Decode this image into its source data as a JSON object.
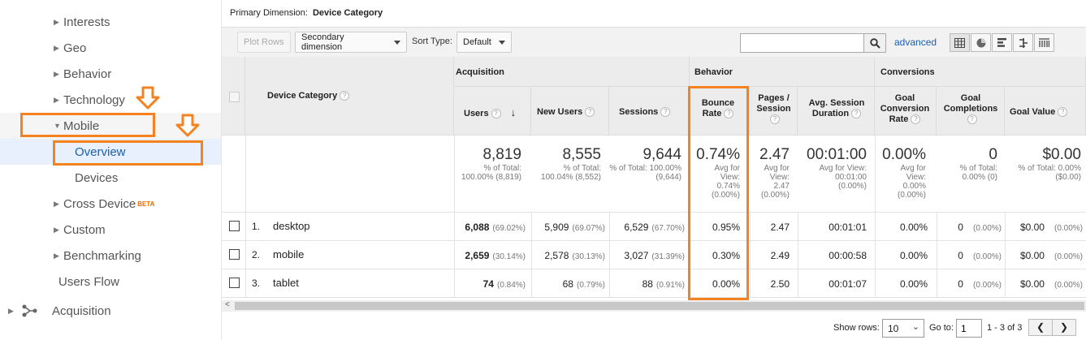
{
  "sidebar": {
    "items": [
      {
        "label": "Interests",
        "arrow": "▶"
      },
      {
        "label": "Geo",
        "arrow": "▶"
      },
      {
        "label": "Behavior",
        "arrow": "▶"
      },
      {
        "label": "Technology",
        "arrow": "▶"
      },
      {
        "label": "Mobile",
        "arrow": "▼"
      },
      {
        "label": "Overview",
        "arrow": ""
      },
      {
        "label": "Devices",
        "arrow": ""
      },
      {
        "label": "Cross Device",
        "arrow": "▶",
        "badge": "BETA"
      },
      {
        "label": "Custom",
        "arrow": "▶"
      },
      {
        "label": "Benchmarking",
        "arrow": "▶"
      },
      {
        "label": "Users Flow",
        "arrow": ""
      }
    ],
    "acquisition": "Acquisition",
    "highlight_color": "#f58220"
  },
  "toolbar": {
    "primary_label": "Primary Dimension:",
    "primary_value": "Device Category",
    "plot_rows": "Plot Rows",
    "secondary": "Secondary dimension",
    "sort_label": "Sort Type:",
    "sort_value": "Default",
    "search_value": "",
    "advanced": "advanced"
  },
  "table": {
    "dimension_header": "Device Category",
    "groups": {
      "acquisition": "Acquisition",
      "behavior": "Behavior",
      "conversions": "Conversions"
    },
    "columns": {
      "users": "Users",
      "new_users": "New Users",
      "sessions": "Sessions",
      "bounce": "Bounce Rate",
      "pages": "Pages / Session",
      "duration": "Avg. Session Duration",
      "conv_rate": "Goal Conversion Rate",
      "completions": "Goal Completions",
      "value": "Goal Value"
    },
    "totals": {
      "users": "8,819",
      "users_sub": "% of Total: 100.00% (8,819)",
      "new_users": "8,555",
      "new_users_sub": "% of Total: 100.04% (8,552)",
      "sessions": "9,644",
      "sessions_sub": "% of Total: 100.00% (9,644)",
      "bounce": "0.74%",
      "bounce_sub": "Avg for View: 0.74% (0.00%)",
      "pages": "2.47",
      "pages_sub": "Avg for View: 2.47 (0.00%)",
      "duration": "00:01:00",
      "duration_sub": "Avg for View: 00:01:00 (0.00%)",
      "conv_rate": "0.00%",
      "conv_rate_sub": "Avg for View: 0.00% (0.00%)",
      "completions": "0",
      "completions_sub": "% of Total: 0.00% (0)",
      "value": "$0.00",
      "value_sub": "% of Total: 0.00% ($0.00)"
    },
    "rows": [
      {
        "idx": "1.",
        "name": "desktop",
        "users": "6,088",
        "users_pct": "(69.02%)",
        "new_users": "5,909",
        "new_users_pct": "(69.07%)",
        "sessions": "6,529",
        "sessions_pct": "(67.70%)",
        "bounce": "0.95%",
        "pages": "2.47",
        "duration": "00:01:01",
        "conv_rate": "0.00%",
        "completions": "0",
        "completions_pct": "(0.00%)",
        "value": "$0.00",
        "value_pct": "(0.00%)"
      },
      {
        "idx": "2.",
        "name": "mobile",
        "users": "2,659",
        "users_pct": "(30.14%)",
        "new_users": "2,578",
        "new_users_pct": "(30.13%)",
        "sessions": "3,027",
        "sessions_pct": "(31.39%)",
        "bounce": "0.30%",
        "pages": "2.49",
        "duration": "00:00:58",
        "conv_rate": "0.00%",
        "completions": "0",
        "completions_pct": "(0.00%)",
        "value": "$0.00",
        "value_pct": "(0.00%)"
      },
      {
        "idx": "3.",
        "name": "tablet",
        "users": "74",
        "users_pct": "(0.84%)",
        "new_users": "68",
        "new_users_pct": "(0.79%)",
        "sessions": "88",
        "sessions_pct": "(0.91%)",
        "bounce": "0.00%",
        "pages": "2.50",
        "duration": "00:01:07",
        "conv_rate": "0.00%",
        "completions": "0",
        "completions_pct": "(0.00%)",
        "value": "$0.00",
        "value_pct": "(0.00%)"
      }
    ]
  },
  "footer": {
    "show_rows_label": "Show rows:",
    "show_rows_value": "10",
    "goto_label": "Go to:",
    "goto_value": "1",
    "range": "1 - 3 of 3"
  },
  "colors": {
    "highlight": "#f58220",
    "link": "#1a5fb4",
    "header_bg": "#ececec"
  }
}
